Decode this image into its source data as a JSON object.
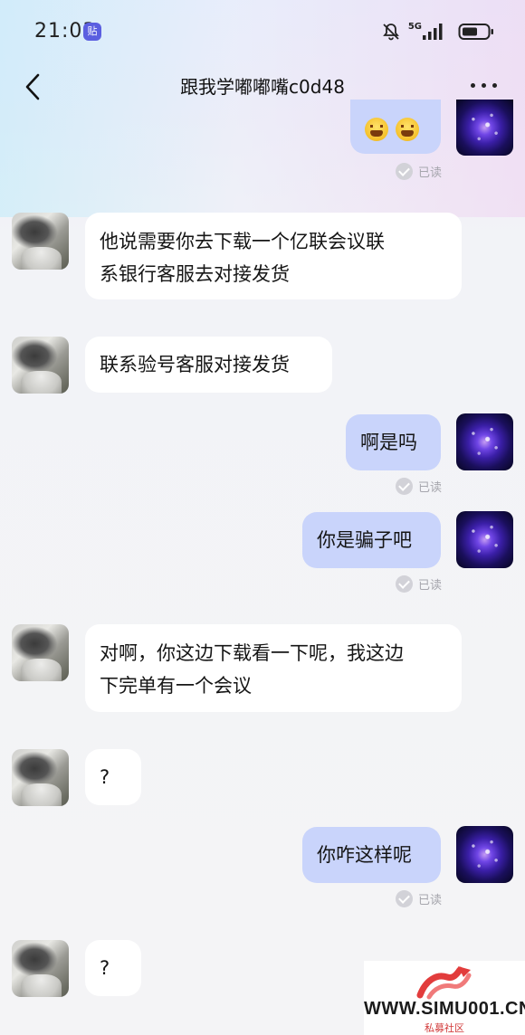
{
  "status_bar": {
    "time": "21:03",
    "paste_badge": "贴",
    "network": "5G",
    "icons": [
      "mute-bell-icon",
      "signal-icon",
      "battery-icon"
    ]
  },
  "header": {
    "title": "跟我学嘟嘟嘴c0d48",
    "back_icon": "chevron-left-icon",
    "more_icon": "more-dots-icon"
  },
  "read_label": "已读",
  "messages": [
    {
      "side": "out",
      "text": "",
      "content": "emoji-pair",
      "read": "已读"
    },
    {
      "side": "in",
      "lines": [
        "他说需要你去下载一个亿联会议联",
        "系银行客服去对接发货"
      ]
    },
    {
      "side": "in",
      "lines": [
        "联系验号客服对接发货"
      ]
    },
    {
      "side": "out",
      "lines": [
        "啊是吗"
      ],
      "read": "已读"
    },
    {
      "side": "out",
      "lines": [
        "你是骗子吧"
      ],
      "read": "已读"
    },
    {
      "side": "in",
      "lines": [
        "对啊，你这边下载看一下呢，我这边",
        "下完单有一个会议"
      ]
    },
    {
      "side": "in",
      "lines": [
        "?"
      ]
    },
    {
      "side": "out",
      "lines": [
        "你咋这样呢"
      ],
      "read": "已读"
    },
    {
      "side": "in",
      "lines": [
        "?"
      ]
    }
  ],
  "watermark": {
    "site": "WWW.SIMU001.CN",
    "subtitle": "私募社区"
  },
  "colors": {
    "outgoing_bubble": "#c9d4fb",
    "incoming_bubble": "#ffffff",
    "read_text": "#a6a6ad",
    "watermark_accent": "#e23c3c"
  }
}
